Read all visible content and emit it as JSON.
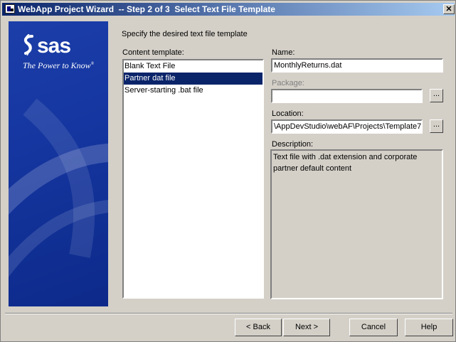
{
  "window": {
    "title": "WebApp Project Wizard  -- Step 2 of 3  Select Text File Template",
    "close": "✕"
  },
  "banner": {
    "logo": "sas",
    "tagline": "The Power to Know",
    "brand_color": "#1536a0"
  },
  "main": {
    "prompt": "Specify the desired text file template",
    "content_template_label": "Content template:",
    "templates": [
      "Blank Text File",
      "Partner dat file",
      "Server-starting .bat file"
    ],
    "selected_index": 1
  },
  "form": {
    "name_label": "Name:",
    "name_value": "MonthlyReturns.dat",
    "package_label": "Package:",
    "package_value": "",
    "location_label": "Location:",
    "location_value": "\\AppDevStudio\\webAF\\Projects\\Template7",
    "browse_label": "...",
    "description_label": "Description:",
    "description_value": "Text file with .dat extension and corporate partner default content"
  },
  "buttons": {
    "back": "< Back",
    "next": "Next >",
    "cancel": "Cancel",
    "help": "Help"
  }
}
